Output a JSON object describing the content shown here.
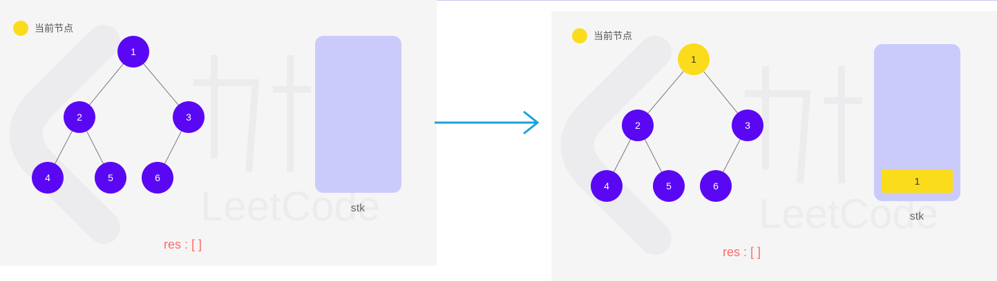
{
  "legend": {
    "label": "当前节点",
    "color": "#fbdc1c"
  },
  "tree": {
    "nodes": [
      "1",
      "2",
      "3",
      "4",
      "5",
      "6"
    ],
    "edges": [
      [
        "1",
        "2"
      ],
      [
        "1",
        "3"
      ],
      [
        "2",
        "4"
      ],
      [
        "2",
        "5"
      ],
      [
        "3",
        "6"
      ]
    ],
    "node_color": "#5a08f4"
  },
  "stack_label": "stk",
  "stack_color": "#cbcbfb",
  "result_text": "res : [ ]",
  "watermark": {
    "logo_text": "LeetCode",
    "chinese": "力扣"
  },
  "states": [
    {
      "current_node": "",
      "stack_items": []
    },
    {
      "current_node": "1",
      "stack_items": [
        "1"
      ]
    }
  ],
  "arrow_color": "#19a1dd"
}
